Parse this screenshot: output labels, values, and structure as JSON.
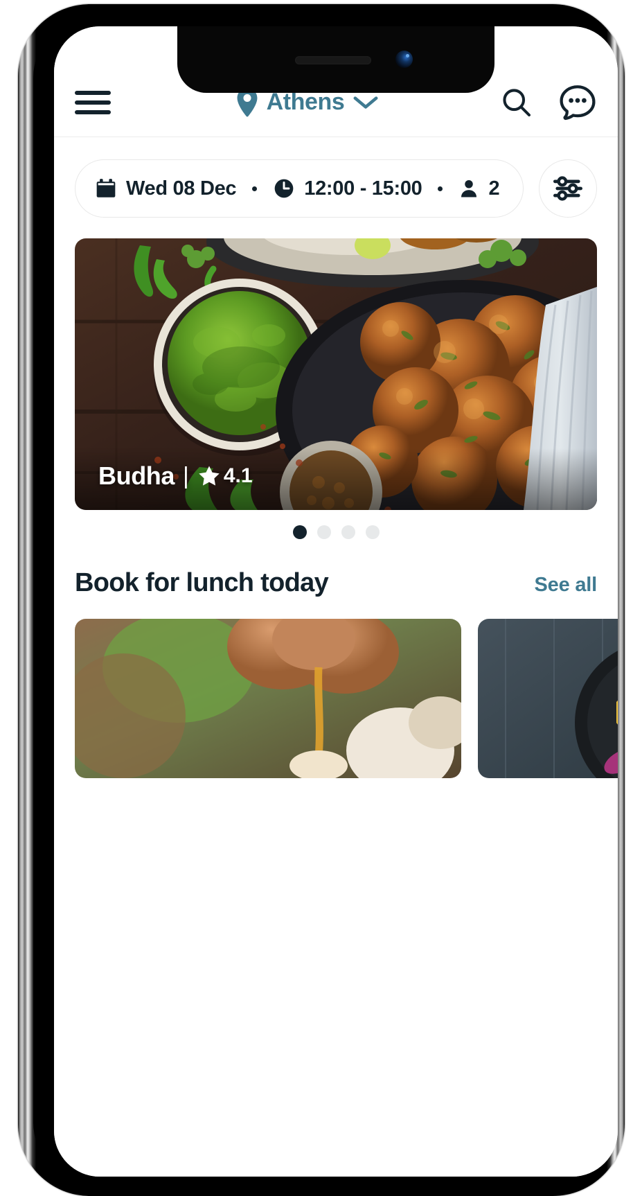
{
  "app": {
    "accent_teal": "#3f7a91",
    "text_dark": "#13222c",
    "background": "#ffffff"
  },
  "header": {
    "menu_icon": "hamburger-menu-icon",
    "location": {
      "pin_icon": "location-pin-icon",
      "label": "Athens",
      "chevron_icon": "chevron-down-icon"
    },
    "search_icon": "search-icon",
    "chat_icon": "chat-bubble-dots-icon"
  },
  "filter_bar": {
    "date": {
      "icon": "calendar-icon",
      "value": "Wed 08 Dec"
    },
    "time": {
      "icon": "clock-icon",
      "value": "12:00 - 15:00"
    },
    "guests": {
      "icon": "person-icon",
      "value": "2"
    },
    "filter_button_icon": "sliders-filter-icon"
  },
  "hero": {
    "restaurant_name": "Budha",
    "separator": "|",
    "star_icon": "star-icon",
    "rating": "4.1",
    "image_alt": "fried-fritters-with-green-chutney-photo"
  },
  "carousel": {
    "dots": [
      {
        "active": true
      },
      {
        "active": false
      },
      {
        "active": false
      },
      {
        "active": false
      }
    ]
  },
  "section": {
    "title": "Book for lunch today",
    "see_all_label": "See all"
  },
  "cards": [
    {
      "image_alt": "hand-pouring-honey-over-food-photo"
    },
    {
      "image_alt": "salad-bowl-on-slate-photo"
    }
  ]
}
